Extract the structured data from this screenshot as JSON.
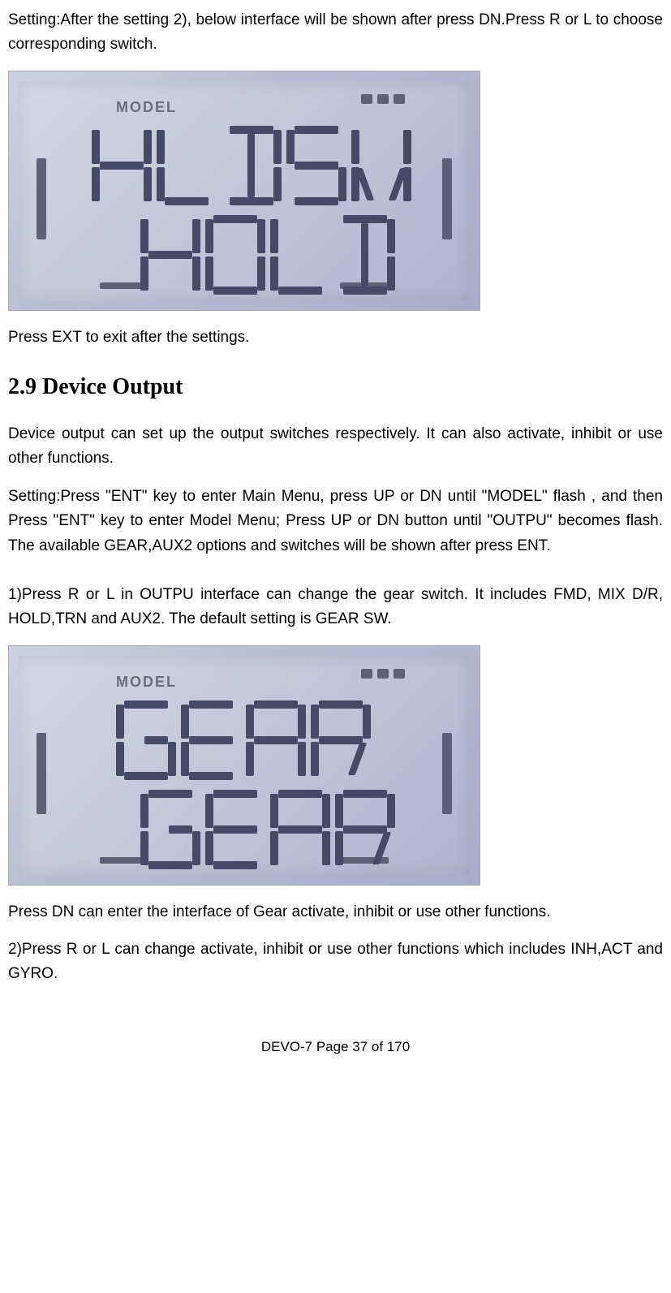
{
  "intro": {
    "p1": "Setting:After the setting 2), below interface will be shown after press DN.Press R or L to choose corresponding switch.",
    "p2": "Press EXT to exit after the settings."
  },
  "section": {
    "heading": "2.9 Device Output",
    "p1": "Device output can set up the output switches respectively. It can also activate, inhibit or use other functions.",
    "p2": "Setting:Press \"ENT\" key to enter Main Menu, press UP or DN until \"MODEL\" flash , and then Press \"ENT\" key to enter Model Menu; Press UP or DN button until \"OUTPU\" becomes flash. The available GEAR,AUX2 options and switches will be shown after press ENT.",
    "p3": "1)Press R or L in OUTPU interface can change the gear switch. It includes FMD, MIX D/R, HOLD,TRN and AUX2. The default setting is GEAR SW.",
    "p4": "Press DN can enter the interface of Gear activate, inhibit or use other functions.",
    "p5": "2)Press R or L can change activate, inhibit or use other functions which includes INH,ACT and GYRO."
  },
  "lcd1": {
    "label": "MODEL",
    "line1": "HLDSW",
    "line2": "HOLD"
  },
  "lcd2": {
    "label": "MODEL",
    "line1": "GEAR",
    "line2": "GEAR"
  },
  "footer": "DEVO-7     Page 37 of 170"
}
